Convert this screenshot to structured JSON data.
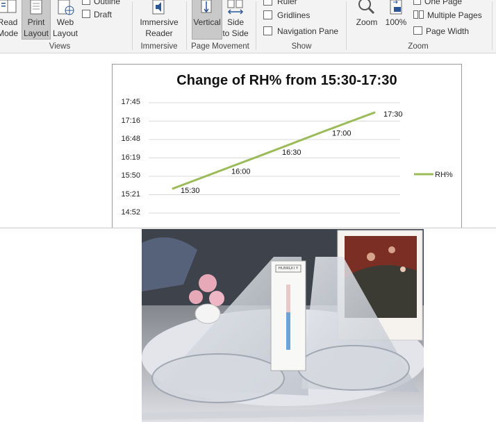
{
  "ribbon": {
    "views": {
      "label": "Views",
      "read_mode": [
        "Read",
        "Mode"
      ],
      "print_layout": [
        "Print",
        "Layout"
      ],
      "web_layout": [
        "Web",
        "Layout"
      ],
      "outline": "Outline",
      "draft": "Draft"
    },
    "immersive": {
      "label": "Immersive",
      "reader": [
        "Immersive",
        "Reader"
      ]
    },
    "page_movement": {
      "label": "Page Movement",
      "vertical": "Vertical",
      "side_to_side": [
        "Side",
        "to Side"
      ]
    },
    "show": {
      "label": "Show",
      "ruler": "Ruler",
      "gridlines": "Gridlines",
      "navigation_pane": "Navigation Pane"
    },
    "zoom": {
      "label": "Zoom",
      "zoom": "Zoom",
      "zoom_100": "100%",
      "one_page": "One Page",
      "multiple_pages": "Multiple Pages",
      "page_width": "Page Width"
    }
  },
  "chart_data": {
    "type": "line",
    "title": "Change of RH% from 15:30-17:30",
    "y_tick_labels": [
      "17:45",
      "17:16",
      "16:48",
      "16:19",
      "15:50",
      "15:21",
      "14:52"
    ],
    "series": [
      {
        "name": "RH%",
        "color": "#9bbb59",
        "values": [
          "15:30",
          "16:00",
          "16:30",
          "17:00",
          "17:30"
        ]
      }
    ],
    "y_minutes": [
      930,
      960,
      990,
      1020,
      1050
    ],
    "ylim_minutes": [
      892,
      1065
    ],
    "legend": "right",
    "grid": true
  },
  "photo": {
    "card_brand": "HUMIDITY",
    "colors": {
      "card_bar": "#6fa3d6",
      "roses": "#e7a9b8"
    }
  }
}
